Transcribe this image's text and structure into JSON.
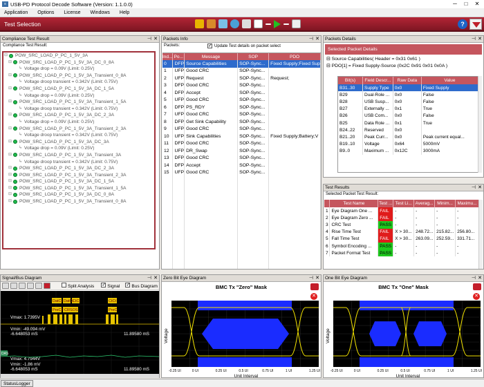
{
  "window": {
    "title": "USB-PD Protocol Decode Software (Version: 1.1.0.0)",
    "min": "─",
    "max": "□",
    "close": "✕"
  },
  "menu": [
    "Application",
    "Options",
    "License",
    "Windows",
    "Help"
  ],
  "ribbon": {
    "title": "Test Selection",
    "help": "?"
  },
  "compliance": {
    "title": "Compliance Test Result",
    "subtitle": "Compliance Test Result:",
    "tree": [
      {
        "t": "POW_SRC_LOAD_P_PC_1_5V_3A",
        "l": 0
      },
      {
        "t": "POW_SRC_LOAD_P_PC_1_5V_3A_DC_0_8A",
        "l": 1
      },
      {
        "t": "Voltage drop = 0.09V (Limit: 0.25V)",
        "l": 2
      },
      {
        "t": "POW_SRC_LOAD_P_PC_1_5V_3A_Transient_0_8A",
        "l": 1
      },
      {
        "t": "Voltage droop transient = 0.342V (Limit: 0.75V)",
        "l": 2
      },
      {
        "t": "POW_SRC_LOAD_P_PC_1_5V_3A_DC_1_5A",
        "l": 1
      },
      {
        "t": "Voltage drop = 0.09V (Limit: 0.25V)",
        "l": 2
      },
      {
        "t": "POW_SRC_LOAD_P_PC_1_5V_3A_Transient_1_5A",
        "l": 1
      },
      {
        "t": "Voltage droop transient = 0.342V (Limit: 0.75V)",
        "l": 2
      },
      {
        "t": "POW_SRC_LOAD_P_PC_1_5V_3A_DC_2_3A",
        "l": 1
      },
      {
        "t": "Voltage drop = 0.09V (Limit: 0.25V)",
        "l": 2
      },
      {
        "t": "POW_SRC_LOAD_P_PC_1_5V_3A_Transient_2_3A",
        "l": 1
      },
      {
        "t": "Voltage droop transient = 0.342V (Limit: 0.75V)",
        "l": 2
      },
      {
        "t": "POW_SRC_LOAD_P_PC_1_5V_3A_DC_3A",
        "l": 1
      },
      {
        "t": "Voltage drop = 0.09V (Limit: 0.25V)",
        "l": 2
      },
      {
        "t": "POW_SRC_LOAD_P_PC_1_5V_3A_Transient_3A",
        "l": 1
      },
      {
        "t": "Voltage droop transient = 0.342V (Limit: 0.75V)",
        "l": 2
      },
      {
        "t": "POW_SRC_LOAD_P_PC_1_5V_3A_DC_2_3A",
        "l": 1
      },
      {
        "t": "POW_SRC_LOAD_P_PC_1_5V_3A_Transient_2_3A",
        "l": 1
      },
      {
        "t": "POW_SRC_LOAD_P_PC_1_5V_3A_DC_1_5A",
        "l": 1
      },
      {
        "t": "POW_SRC_LOAD_P_PC_1_5V_3A_Transient_1_5A",
        "l": 1
      },
      {
        "t": "POW_SRC_LOAD_P_PC_1_5V_3A_DC_0_8A",
        "l": 1
      },
      {
        "t": "POW_SRC_LOAD_P_PC_1_5V_3A_Transient_0_8A",
        "l": 1
      }
    ]
  },
  "packets": {
    "title": "Packets Info",
    "label": "Packets:",
    "checkbox": "Update Test details on packet select",
    "headers": [
      "Ind...",
      "Po...",
      "Message",
      "SOP",
      "PDO"
    ],
    "rows": [
      [
        "0",
        "DFP",
        "Source Capabilities",
        "SOP-Sync...",
        "Fixed Supply;Fixed Sup"
      ],
      [
        "1",
        "UFP",
        "Good CRC",
        "SOP-Sync...",
        ""
      ],
      [
        "2",
        "UFP",
        "Request",
        "SOP-Sync...",
        "Request;"
      ],
      [
        "3",
        "DFP",
        "Good CRC",
        "SOP-Sync...",
        ""
      ],
      [
        "4",
        "DFP",
        "Accept",
        "SOP-Sync...",
        ""
      ],
      [
        "5",
        "UFP",
        "Good CRC",
        "SOP-Sync...",
        ""
      ],
      [
        "6",
        "DFP",
        "PS_RDY",
        "SOP-Sync...",
        ""
      ],
      [
        "7",
        "UFP",
        "Good CRC",
        "SOP-Sync...",
        ""
      ],
      [
        "8",
        "DFP",
        "Get Sink Capability",
        "SOP-Sync...",
        ""
      ],
      [
        "9",
        "UFP",
        "Good CRC",
        "SOP-Sync...",
        ""
      ],
      [
        "10",
        "UFP",
        "Sink Capabilities",
        "SOP-Sync...",
        "Fixed Supply;Battery;V"
      ],
      [
        "11",
        "DFP",
        "Good CRC",
        "SOP-Sync...",
        ""
      ],
      [
        "12",
        "UFP",
        "DR_Swap",
        "SOP-Sync...",
        ""
      ],
      [
        "13",
        "DFP",
        "Good CRC",
        "SOP-Sync...",
        ""
      ],
      [
        "14",
        "DFP",
        "Accept",
        "SOP-Sync...",
        ""
      ],
      [
        "15",
        "UFP",
        "Good CRC",
        "SOP-Sync...",
        ""
      ]
    ]
  },
  "details": {
    "title": "Packets Details",
    "header": "Selected Packet Details",
    "line1": "Source Capabilities( Header =  0x31 0x61 )",
    "line2": "PDO[1] = Fixed Supply-Source (0x2C 0x91 0x01 0x0A )",
    "headers": [
      "Bit(s)",
      "Field Descr...",
      "Raw Data",
      "Value"
    ],
    "rows": [
      [
        "B31..30",
        "Supply Type",
        "0x0",
        "Fixed Supply"
      ],
      [
        "B29",
        "Dual-Role ...",
        "0x0",
        "False"
      ],
      [
        "B28",
        "USB Susp...",
        "0x0",
        "False"
      ],
      [
        "B27",
        "Externally ...",
        "0x1",
        "True"
      ],
      [
        "B26",
        "USB Com...",
        "0x0",
        "False"
      ],
      [
        "B25",
        "Data Role ...",
        "0x1",
        "True"
      ],
      [
        "B24..22",
        "Reserved",
        "0x0",
        ""
      ],
      [
        "B21..20",
        "Peak Curr...",
        "0x0",
        "Peak current equal..."
      ],
      [
        "B19..10",
        "Voltage",
        "0x64",
        "5000mV"
      ],
      [
        "B9..0",
        "Maximum ...",
        "0x12C",
        "3000mA"
      ]
    ]
  },
  "tests": {
    "title": "Test Results",
    "subtitle": "Selected Packet Test Result:",
    "headers": [
      "",
      "Test Name",
      "Test ...",
      "Test Li...",
      "Averag...",
      "Minim...",
      "Maximu..."
    ],
    "rows": [
      [
        "1",
        "Eye Diagram One ...",
        "FAIL",
        "-",
        "-",
        "-",
        "-"
      ],
      [
        "2",
        "Eye Diagram Zero ...",
        "FAIL",
        "-",
        "-",
        "-",
        "-"
      ],
      [
        "3",
        "CRC Test",
        "PASS",
        "-",
        "-",
        "-",
        "-"
      ],
      [
        "4",
        "Rise Time Test",
        "FAIL",
        "X > 30...",
        "248.72...",
        "215.82...",
        "256.80..."
      ],
      [
        "5",
        "Fall Time Test",
        "FAIL",
        "X > 30...",
        "263.09...",
        "252.59...",
        "331.71..."
      ],
      [
        "6",
        "Symbol Encoding ...",
        "PASS",
        "-",
        "-",
        "-",
        "-"
      ],
      [
        "7",
        "Packet Format Test",
        "PASS",
        "-",
        "-",
        "-",
        "-"
      ]
    ]
  },
  "signal": {
    "title": "Signal/Bus Diagram",
    "split": "Split Analysis",
    "signal": "Signal",
    "bus": "Bus Diagram",
    "labels": [
      "DatCt",
      "DatCt",
      "CtCt",
      "PreCF",
      "CRSOS",
      "PreC"
    ],
    "vmax1": "Vmax: 1.7395V",
    "vmin1": "Vmin: -49.094 mV",
    "t1": "-6.648053 mS",
    "t2": "11.89580 mS",
    "vmax2": "Vmax: 4.7944V",
    "vmin2": "Vmin: -1.86 mV",
    "t3": "-6.648053 mS",
    "t4": "11.89580 mS",
    "ch": "DAS"
  },
  "eye0": {
    "title": "Zero Bit Eye Diagram",
    "heading": "BMC Tx \"Zero\" Mask",
    "xlabel": "Unit Interval",
    "ylabel": "Voltage",
    "ticks": [
      "-0.25 UI",
      "0 UI",
      "0.25 UI",
      "0.5 UI",
      "0.75 UI",
      "1 UI",
      "1.25 UI"
    ]
  },
  "eye1": {
    "title": "One Bit Eye Diagram",
    "heading": "BMC Tx \"One\" Mask",
    "xlabel": "Unit Interval",
    "ylabel": "Voltage",
    "ticks": [
      "-0.25 UI",
      "0 UI",
      "0.25 UI",
      "0.5 UI",
      "0.75 UI",
      "1 UI",
      "1.25 UI"
    ]
  },
  "status": "StatusLogger",
  "colors": {
    "accent": "#b32535",
    "pass": "#1ec81e",
    "fail": "#e01b1b",
    "mask": "#1a2cff",
    "selected": "#2e6bcc"
  }
}
